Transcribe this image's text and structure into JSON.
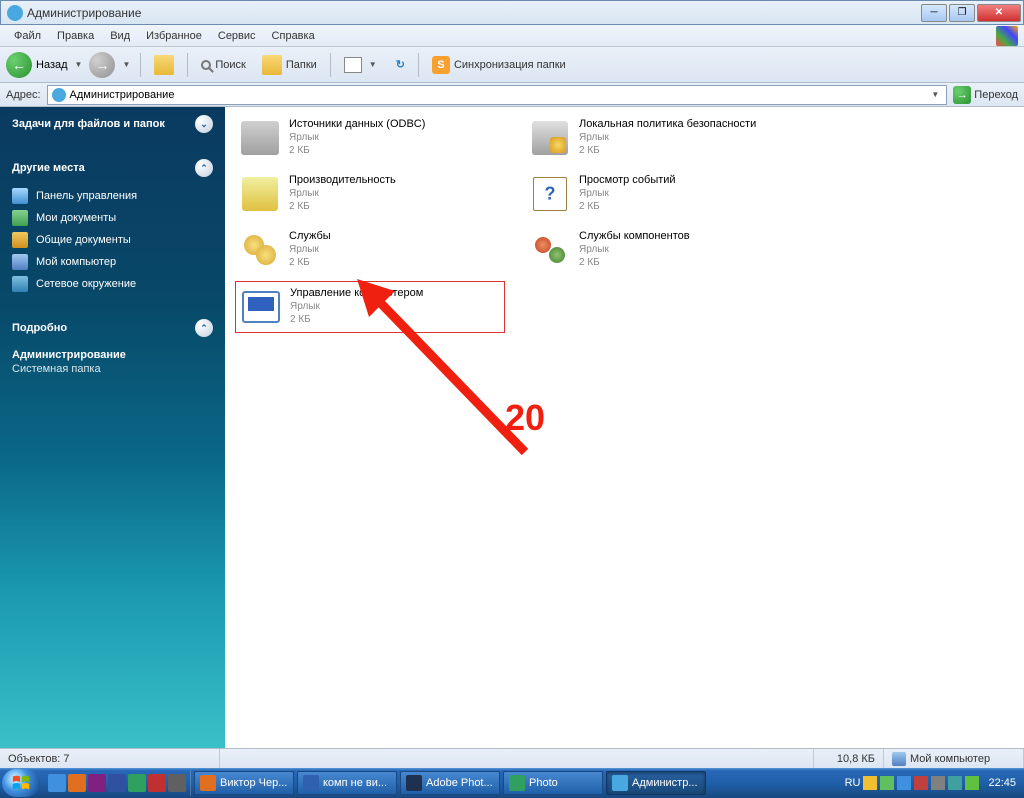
{
  "window": {
    "title": "Администрирование"
  },
  "menu": {
    "file": "Файл",
    "edit": "Правка",
    "view": "Вид",
    "favorites": "Избранное",
    "tools": "Сервис",
    "help": "Справка"
  },
  "toolbar": {
    "back": "Назад",
    "search": "Поиск",
    "folders": "Папки",
    "sync": "Синхронизация папки",
    "sync_icon_letter": "S"
  },
  "address": {
    "label": "Адрес:",
    "value": "Администрирование",
    "go": "Переход"
  },
  "sidebar": {
    "tasks": {
      "header": "Задачи для файлов и папок"
    },
    "places": {
      "header": "Другие места",
      "items": [
        "Панель управления",
        "Мои документы",
        "Общие документы",
        "Мой компьютер",
        "Сетевое окружение"
      ]
    },
    "details": {
      "header": "Подробно",
      "title": "Администрирование",
      "sub": "Системная папка"
    }
  },
  "items": {
    "type_label": "Ярлык",
    "size_label": "2 КБ",
    "col1": [
      {
        "name": "Источники данных (ODBC)",
        "icon": "fi-odbc"
      },
      {
        "name": "Производительность",
        "icon": "fi-perf"
      },
      {
        "name": "Службы",
        "icon": "fi-svc"
      },
      {
        "name": "Управление компьютером",
        "icon": "fi-comp",
        "hl": true
      }
    ],
    "col2": [
      {
        "name": "Локальная политика безопасности",
        "icon": "fi-secpol"
      },
      {
        "name": "Просмотр событий",
        "icon": "fi-event"
      },
      {
        "name": "Службы компонентов",
        "icon": "fi-compsvc"
      }
    ]
  },
  "annotation": {
    "number": "20"
  },
  "statusbar": {
    "objects": "Объектов: 7",
    "size": "10,8 КБ",
    "location": "Мой компьютер"
  },
  "taskbar": {
    "items": [
      {
        "label": "Виктор Чер...",
        "color": "#e07020"
      },
      {
        "label": "комп не ви...",
        "color": "#3060b0"
      },
      {
        "label": "Adobe Phot...",
        "color": "#203050"
      },
      {
        "label": "Photo",
        "color": "#30a060"
      },
      {
        "label": "Администр...",
        "color": "#4aa8e0",
        "active": true
      }
    ],
    "lang": "RU",
    "time": "22:45"
  }
}
